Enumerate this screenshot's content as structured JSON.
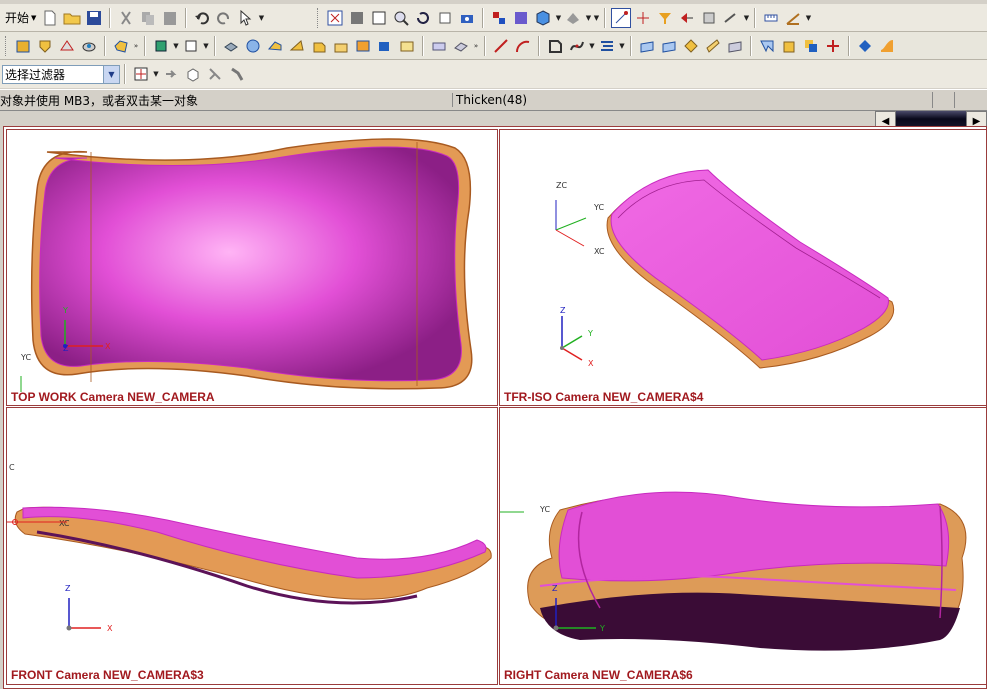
{
  "toolbar1": {
    "start_label": "开始",
    "icons": [
      "new-file-icon",
      "open-folder-icon",
      "save-icon",
      "cut-icon",
      "copy-icon",
      "paste-icon",
      "undo-icon",
      "redo-icon",
      "select-cursor-icon",
      "fit-view-icon",
      "zoom-box-icon",
      "zoom-area-icon",
      "zoom-magnify-icon",
      "rotate-icon",
      "pan-icon",
      "camera-icon",
      "layer-icon",
      "layer-visible-icon",
      "render-style-icon",
      "shading-icon",
      "snap-icon",
      "snap-point-icon",
      "selection-filter-icon",
      "measure-distance-icon",
      "measure-angle-icon",
      "ruler-icon",
      "protractor-icon"
    ]
  },
  "toolbar2": {
    "icons": [
      "book-icon",
      "shield-icon",
      "part-icon",
      "analysis-icon",
      "feature-icon",
      "sketch-icon",
      "block-icon",
      "cylinder-icon",
      "extrude-icon",
      "revolve-icon",
      "sweep-icon",
      "hole-icon",
      "boss-icon",
      "chamfer-icon",
      "blend-icon",
      "shell-icon",
      "offset-icon",
      "line-icon",
      "arc-icon",
      "curve-icon",
      "spline-icon",
      "surface-icon",
      "sew-icon",
      "trim-icon",
      "extend-icon",
      "fill-icon",
      "thicken-icon",
      "transform-icon",
      "pattern-icon",
      "mirror-icon",
      "boolean-icon",
      "sheet-metal-icon"
    ]
  },
  "toolbar3": {
    "filter_label": "选择过滤器",
    "icons": [
      "select-all-icon",
      "undo-select-icon",
      "box-select-icon",
      "pick-point-icon",
      "pick-feature-icon"
    ]
  },
  "statusbar": {
    "prompt": "对象并使用 MB3，或者双击某一对象",
    "status": "Thicken(48)"
  },
  "viewports": [
    {
      "label": "TOP WORK Camera NEW_CAMERA",
      "axes": {
        "a": "Y",
        "b": "X",
        "c": "Z",
        "world": "YC"
      }
    },
    {
      "label": "TFR-ISO Camera NEW_CAMERA$4",
      "axes": {
        "a": "Z",
        "b": "Y",
        "c": "X",
        "world_z": "ZC",
        "world_y": "YC",
        "world_x": "XC"
      }
    },
    {
      "label": "FRONT Camera NEW_CAMERA$3",
      "axes": {
        "a": "Z",
        "b": "X",
        "world_z": "C",
        "world_x": "XC"
      }
    },
    {
      "label": "RIGHT Camera NEW_CAMERA$6",
      "axes": {
        "a": "Z",
        "b": "Y",
        "world_y": "YC"
      }
    }
  ],
  "colors": {
    "part_face": "#e24fd6",
    "part_edge": "#d88a3e",
    "label": "#a1191e",
    "border": "#9a3c3c",
    "axis_x": "#e02020",
    "axis_y": "#20b020",
    "axis_z": "#2020c0"
  }
}
